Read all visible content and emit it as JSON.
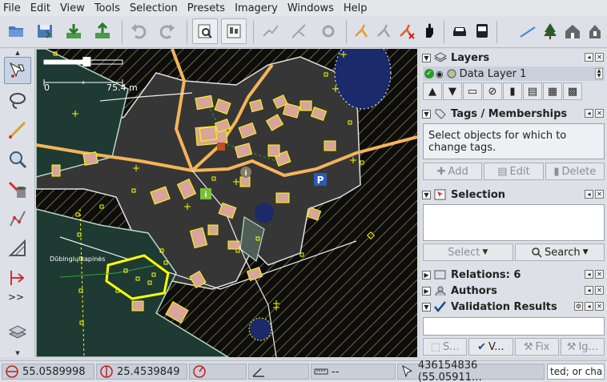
{
  "menu": [
    "File",
    "Edit",
    "View",
    "Tools",
    "Selection",
    "Presets",
    "Imagery",
    "Windows",
    "Help"
  ],
  "toolbar_icons": [
    "open-icon",
    "save-icon",
    "download-icon",
    "upload-icon",
    "undo-icon",
    "redo-icon",
    "preferences-icon",
    "presets-icon",
    "split-way-icon",
    "combine-way-icon",
    "reverse-icon",
    "walking-icon",
    "cycling-icon",
    "cancel-icon",
    "hand-icon",
    "car-icon",
    "bus-icon",
    "line-icon",
    "tree-icon",
    "house-icon",
    "house-note-icon"
  ],
  "left_tools": [
    "select-tool-icon",
    "lasso-tool-icon",
    "draw-tool-icon",
    "zoom-tool-icon",
    "delete-tool-icon",
    "improve-way-tool-icon",
    "parallel-tool-icon",
    "extrude-tool-icon"
  ],
  "left_more": ">>",
  "map": {
    "scale_zero": "0",
    "scale_distance": "75.4 m",
    "place_label": "Dūbingių kapinės",
    "zoom_level": 0.55
  },
  "panels": {
    "layers": {
      "title": "Layers",
      "active_layer": "Data Layer 1"
    },
    "tags": {
      "title": "Tags / Memberships",
      "message": "Select objects for which to change tags.",
      "add": "Add",
      "edit": "Edit",
      "delete": "Delete"
    },
    "selection": {
      "title": "Selection",
      "select": "Select",
      "search": "Search"
    },
    "relations": {
      "title": "Relations: 6"
    },
    "authors": {
      "title": "Authors"
    },
    "validation": {
      "title": "Validation Results",
      "btn_s": "S...",
      "btn_v": "V...",
      "btn_fix": "Fix",
      "btn_ig": "Ig..."
    }
  },
  "status": {
    "lat": "55.0589998",
    "lon": "25.4539849",
    "heading": "",
    "angle": "",
    "distance": "--",
    "object": "436154836 (55.05911…",
    "filter_text": "ted; or cha"
  },
  "colors": {
    "map_bg": "#0d0d0d",
    "road": "#f5b45a",
    "building": "#d8a49c",
    "landuse": "#b8d8cc",
    "node": "#ffff00",
    "water": "#1a2a6a"
  }
}
